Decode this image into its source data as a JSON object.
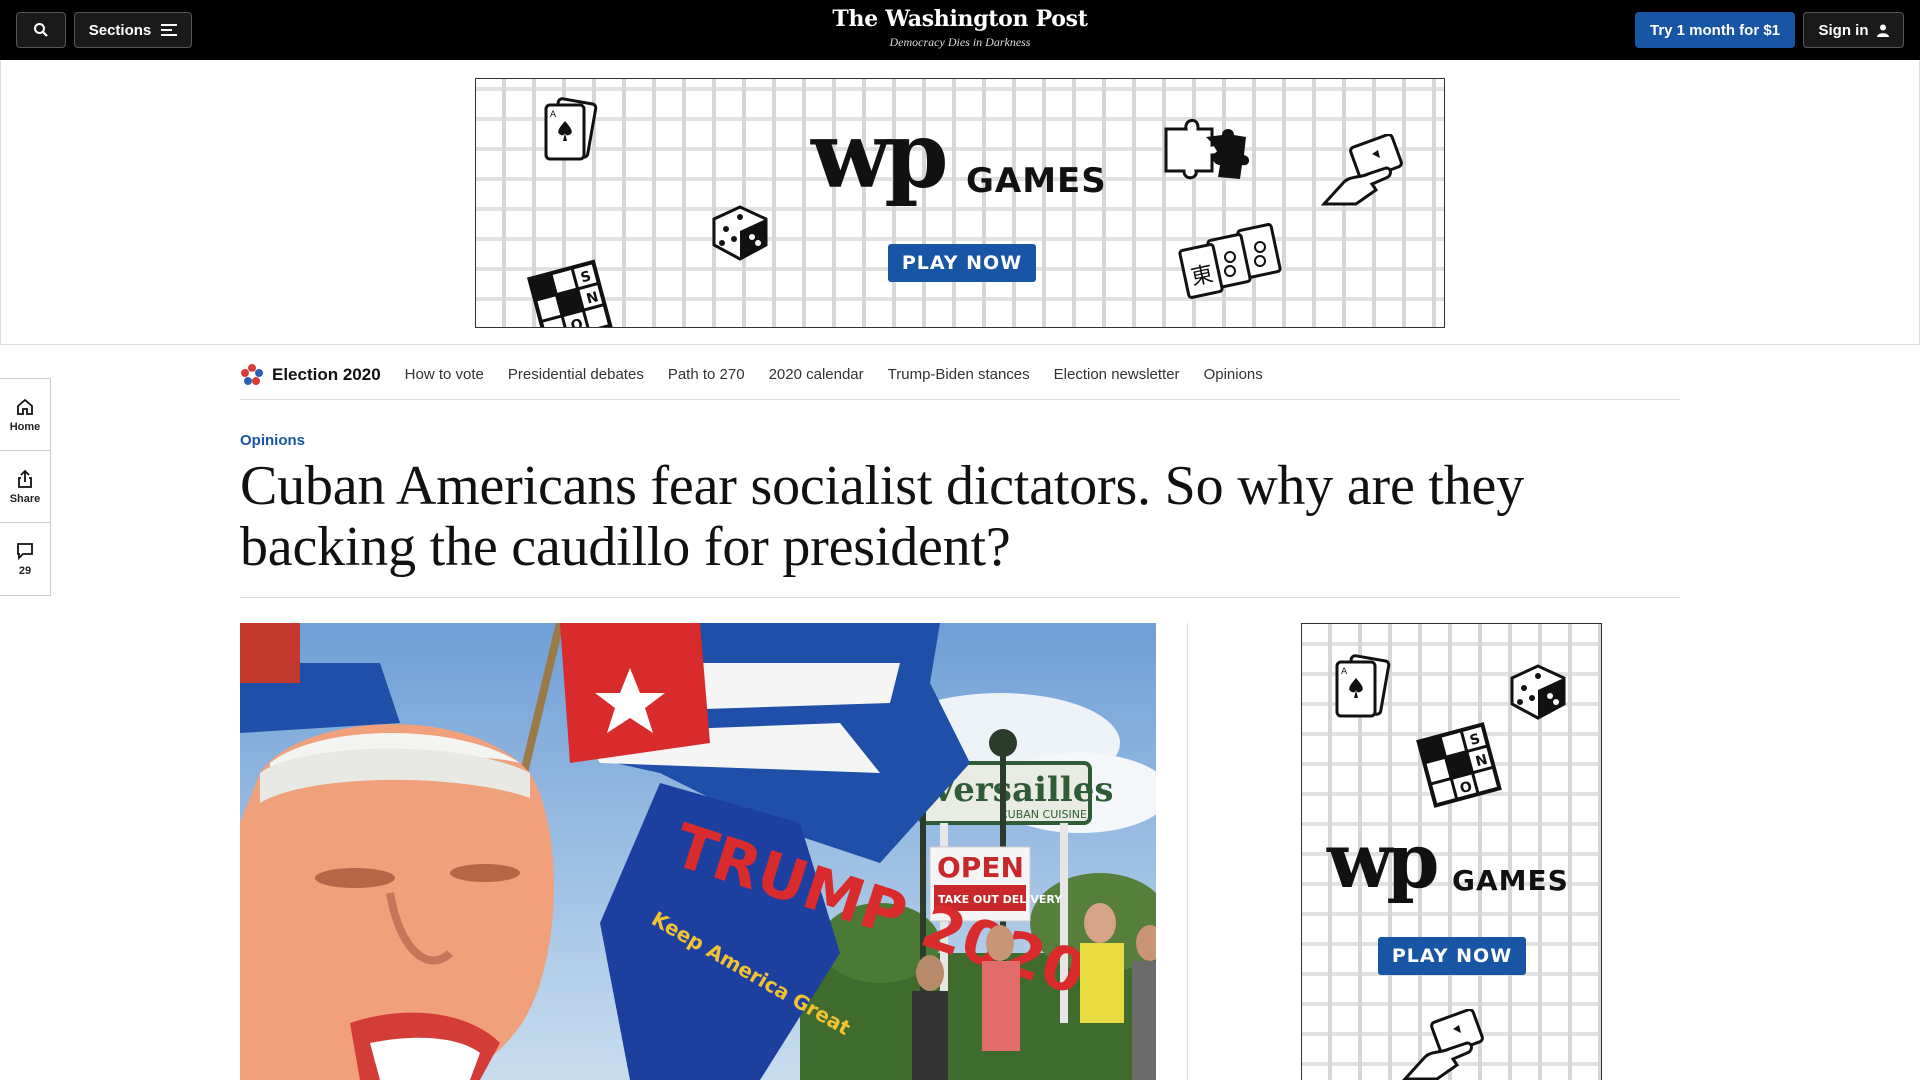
{
  "topbar": {
    "sections_label": "Sections",
    "masthead_logo": "The Washington Post",
    "masthead_tagline": "Democracy Dies in Darkness",
    "try_label": "Try 1 month for $1",
    "signin_label": "Sign in"
  },
  "ad_banner": {
    "logo": "wp",
    "games": "GAMES",
    "play_label": "PLAY NOW"
  },
  "rail": {
    "home_label": "Home",
    "share_label": "Share",
    "comments_count": "29"
  },
  "election_nav": {
    "brand": "Election 2020",
    "links": [
      "How to vote",
      "Presidential debates",
      "Path to 270",
      "2020 calendar",
      "Trump-Biden stances",
      "Election newsletter",
      "Opinions"
    ]
  },
  "article": {
    "kicker": "Opinions",
    "headline": "Cuban Americans fear socialist dictators. So why are they backing the caudillo for president?"
  },
  "photo": {
    "sign_brand": "Versailles",
    "sign_sub": "CUBAN CUISINE",
    "open_sign": "OPEN",
    "takeout": "TAKE OUT DELIVERY",
    "banner_text": "TRUMP 2020",
    "banner_slogan": "Keep America Great"
  },
  "side_ad": {
    "logo": "wp",
    "games": "GAMES",
    "play_label": "PLAY NOW"
  },
  "colors": {
    "accent": "#1955a5",
    "topbar": "#000000"
  }
}
